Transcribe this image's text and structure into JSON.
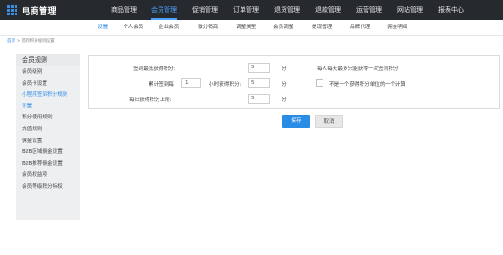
{
  "app": {
    "title": "电商管理"
  },
  "nav": {
    "items": [
      {
        "label": "商品管理"
      },
      {
        "label": "会员管理"
      },
      {
        "label": "促销管理"
      },
      {
        "label": "订单管理"
      },
      {
        "label": "退货管理"
      },
      {
        "label": "退款管理"
      },
      {
        "label": "运营管理"
      },
      {
        "label": "网站管理"
      },
      {
        "label": "报表中心"
      }
    ],
    "active_index": 1
  },
  "subnav": {
    "items": [
      {
        "label": "设置"
      },
      {
        "label": "个人会员"
      },
      {
        "label": "企业会员"
      },
      {
        "label": "微分销商"
      },
      {
        "label": "调整类型"
      },
      {
        "label": "会员调整"
      },
      {
        "label": "提现管理"
      },
      {
        "label": "品牌代理"
      },
      {
        "label": "佣金明细"
      }
    ],
    "active_index": 0
  },
  "breadcrumb": {
    "root": "首页",
    "separator": ">",
    "current": "签到积分规则设置"
  },
  "sidebar": {
    "title": "会员规则",
    "items": [
      {
        "label": "会员级别"
      },
      {
        "label": "会员卡设置"
      },
      {
        "label": "小程序签到积分规则"
      },
      {
        "label": "设置"
      },
      {
        "label": "积分使用规则"
      },
      {
        "label": "充值规则"
      },
      {
        "label": "佣金设置"
      },
      {
        "label": "B2B区域佣金设置"
      },
      {
        "label": "B2B推荐佣金设置"
      },
      {
        "label": "会员权益项"
      },
      {
        "label": "会员等级积分特权"
      }
    ],
    "active_indices": [
      2,
      3
    ]
  },
  "form": {
    "row1": {
      "label": "签到最低获得积分:",
      "value": "5",
      "unit": "分",
      "note": "每人每天最多只能获得一次签到积分"
    },
    "row2": {
      "label": "累计签到每",
      "days_value": "1",
      "middle": "小时获得积分:",
      "value": "5",
      "unit": "分",
      "checkbox_label": "不是一个获得积分单位的一个计算",
      "checked": false
    },
    "row3": {
      "label": "每日获得积分上限:",
      "value": "5",
      "unit": "分"
    }
  },
  "buttons": {
    "save": "保存",
    "cancel": "取消"
  },
  "colors": {
    "topbar": "#26292e",
    "accent": "#2b8ce6",
    "logo": "#3b8de0"
  }
}
